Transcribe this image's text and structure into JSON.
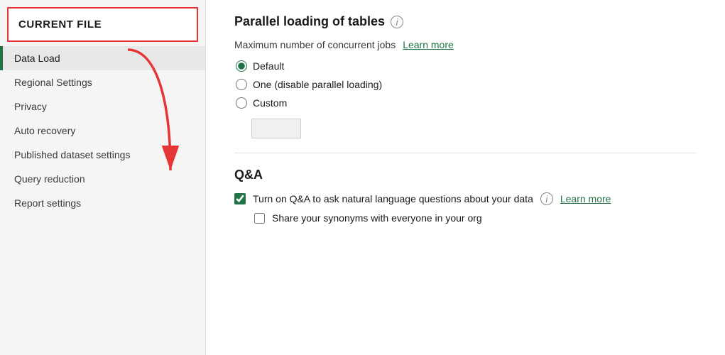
{
  "sidebar": {
    "header": "CURRENT FILE",
    "items": [
      {
        "id": "data-load",
        "label": "Data Load",
        "active": true
      },
      {
        "id": "regional-settings",
        "label": "Regional Settings",
        "active": false
      },
      {
        "id": "privacy",
        "label": "Privacy",
        "active": false
      },
      {
        "id": "auto-recovery",
        "label": "Auto recovery",
        "active": false
      },
      {
        "id": "published-dataset-settings",
        "label": "Published dataset settings",
        "active": false
      },
      {
        "id": "query-reduction",
        "label": "Query reduction",
        "active": false
      },
      {
        "id": "report-settings",
        "label": "Report settings",
        "active": false
      }
    ]
  },
  "main": {
    "parallel_loading": {
      "title": "Parallel loading of tables",
      "concurrent_jobs_label": "Maximum number of concurrent jobs",
      "learn_more_label": "Learn more",
      "options": [
        {
          "id": "default",
          "label": "Default",
          "checked": true
        },
        {
          "id": "one",
          "label": "One (disable parallel loading)",
          "checked": false
        },
        {
          "id": "custom",
          "label": "Custom",
          "checked": false
        }
      ],
      "custom_input_value": ""
    },
    "qa": {
      "title": "Q&A",
      "turn_on_label": "Turn on Q&A to ask natural language questions about your data",
      "turn_on_checked": true,
      "learn_more_label": "Learn more",
      "share_synonyms_label": "Share your synonyms with everyone in your org",
      "share_synonyms_checked": false
    }
  },
  "colors": {
    "accent_green": "#217346",
    "border_red": "#e63535"
  }
}
